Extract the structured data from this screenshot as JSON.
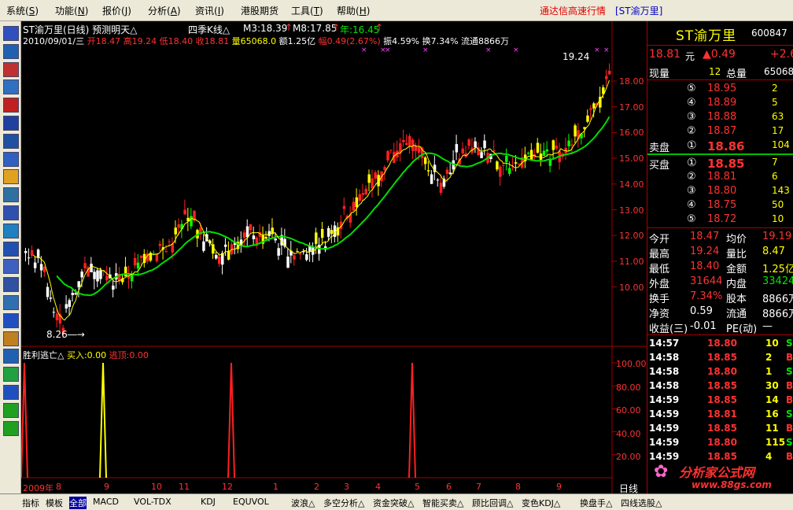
{
  "menu": [
    "系统",
    "功能",
    "报价",
    "分析",
    "资讯",
    "港股期货",
    "工具",
    "帮助"
  ],
  "menu_keys": [
    "S",
    "N",
    "J",
    "A",
    "I",
    "",
    "T",
    "H"
  ],
  "window_title": "通达信高速行情",
  "window_stock": "[ST渝万里]",
  "chart": {
    "header": "ST渝万里(日线) 预测明天△",
    "ma_label": "四季K线△",
    "m3": "M3:18.39",
    "m8": "M8:17.85",
    "year": "年:16.45",
    "info_date": "2010/09/01/三",
    "info_open": "开18.47",
    "info_high": "高19.24",
    "info_low": "低18.40",
    "info_close": "收18.81",
    "info_vol": "量65068.0",
    "info_amt": "额1.25亿",
    "info_chg": "幅0.49(2.67%)",
    "info_amp": "振4.59%",
    "info_turn": "换7.34%",
    "info_float": "流通8866万",
    "high_label": "19.24",
    "low_label": "8.26",
    "y_ticks": [
      "18.00",
      "17.00",
      "16.00",
      "15.00",
      "14.00",
      "13.00",
      "12.00",
      "11.00",
      "10.00"
    ],
    "x_labels": [
      "2009年",
      "8",
      "9",
      "10",
      "11",
      "12",
      "1",
      "2",
      "3",
      "4",
      "5",
      "6",
      "7",
      "8",
      "9"
    ]
  },
  "indicator": {
    "title": "胜利逃亡△",
    "buy": "买入:0.00",
    "sell": "逃顶:0.00",
    "y_ticks": [
      "100.00",
      "80.00",
      "60.00",
      "40.00",
      "20.00"
    ]
  },
  "side_period": "日线",
  "quote": {
    "name": "ST渝万里",
    "code": "600847",
    "price": "18.81",
    "unit": "元",
    "change": "▲0.49",
    "pct": "+2.6",
    "now_vol_label": "现量",
    "now_vol": "12",
    "total_vol_label": "总量",
    "total_vol": "65068",
    "sell_label": "卖盘",
    "buy_label": "买盘",
    "asks": [
      {
        "lvl": "⑤",
        "price": "18.95",
        "vol": "2"
      },
      {
        "lvl": "④",
        "price": "18.89",
        "vol": "5"
      },
      {
        "lvl": "③",
        "price": "18.88",
        "vol": "63"
      },
      {
        "lvl": "②",
        "price": "18.87",
        "vol": "17"
      },
      {
        "lvl": "①",
        "price": "18.86",
        "vol": "104"
      }
    ],
    "bids": [
      {
        "lvl": "①",
        "price": "18.85",
        "vol": "7"
      },
      {
        "lvl": "②",
        "price": "18.81",
        "vol": "6"
      },
      {
        "lvl": "③",
        "price": "18.80",
        "vol": "143"
      },
      {
        "lvl": "④",
        "price": "18.75",
        "vol": "50"
      },
      {
        "lvl": "⑤",
        "price": "18.72",
        "vol": "10"
      }
    ],
    "stats": [
      {
        "l1": "今开",
        "v1": "18.47",
        "l2": "均价",
        "v2": "19.19"
      },
      {
        "l1": "最高",
        "v1": "19.24",
        "l2": "量比",
        "v2": "8.47"
      },
      {
        "l1": "最低",
        "v1": "18.40",
        "l2": "金额",
        "v2": "1.25亿"
      },
      {
        "l1": "外盘",
        "v1": "31644",
        "l2": "内盘",
        "v2": "33424"
      },
      {
        "l1": "换手",
        "v1": "7.34%",
        "l2": "股本",
        "v2": "8866万"
      },
      {
        "l1": "净资",
        "v1": "0.59",
        "l2": "流通",
        "v2": "8866万"
      },
      {
        "l1": "收益(三)",
        "v1": "-0.01",
        "l2": "PE(动)",
        "v2": "—"
      }
    ],
    "ticks": [
      {
        "time": "14:57",
        "price": "18.80",
        "vol": "10",
        "side": "S"
      },
      {
        "time": "14:58",
        "price": "18.85",
        "vol": "2",
        "side": "B"
      },
      {
        "time": "14:58",
        "price": "18.80",
        "vol": "1",
        "side": "S"
      },
      {
        "time": "14:58",
        "price": "18.85",
        "vol": "30",
        "side": "B"
      },
      {
        "time": "14:59",
        "price": "18.85",
        "vol": "14",
        "side": "B"
      },
      {
        "time": "14:59",
        "price": "18.81",
        "vol": "16",
        "side": "S"
      },
      {
        "time": "14:59",
        "price": "18.85",
        "vol": "11",
        "side": "B"
      },
      {
        "time": "14:59",
        "price": "18.80",
        "vol": "115",
        "side": "S"
      },
      {
        "time": "14:59",
        "price": "18.85",
        "vol": "4",
        "side": "B"
      }
    ]
  },
  "watermark": {
    "brand": "分析家公式网",
    "url": "www.88gs.com"
  },
  "bottom_tabs": [
    "指标",
    "模板",
    "全部",
    "MACD",
    "VOL-TDX",
    "KDJ",
    "EQUVOL",
    "波浪△",
    "多空分析△",
    "资金突破△",
    "智能买卖△",
    "顾比回调△",
    "变色KDJ△",
    "换盘手△",
    "四线选股△"
  ],
  "toolbar_icons": [
    "chart-icon",
    "list-icon",
    "window-icon",
    "line-chart-icon",
    "kline-icon",
    "grid-icon",
    "table-icon",
    "doc-icon",
    "news-icon",
    "users-icon",
    "f10-icon",
    "globe-icon",
    "eit-icon",
    "wave-icon",
    "rsi-icon",
    "screen-icon",
    "window2-icon",
    "key-icon",
    "tool-icon",
    "exit-icon",
    "cross-icon",
    "up-arrow-icon",
    "down-arrow-icon"
  ]
}
